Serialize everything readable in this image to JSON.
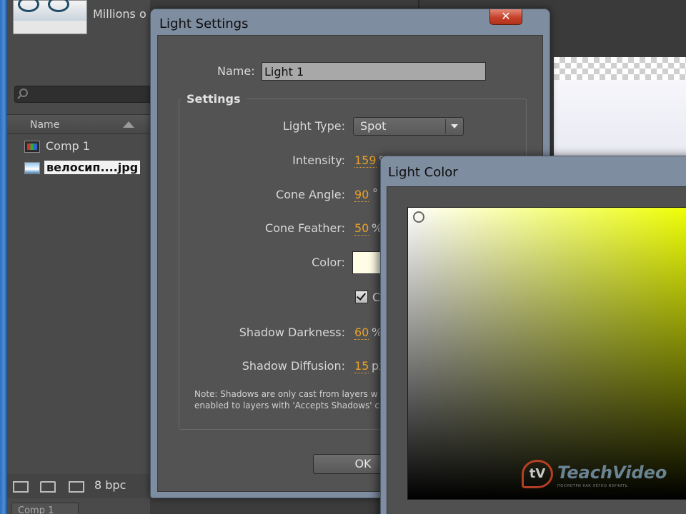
{
  "project_panel": {
    "thumb_info": "Millions o",
    "search_placeholder": "",
    "column_name": "Name",
    "items": [
      {
        "label": "Comp 1",
        "icon": "composition-icon",
        "selected": false
      },
      {
        "label": "велосип....jpg",
        "icon": "image-file-icon",
        "selected": true
      }
    ],
    "bpc": "8 bpc",
    "bottom_tab": "Comp 1"
  },
  "light_settings": {
    "title": "Light Settings",
    "close": "✕",
    "name_label": "Name:",
    "name_value": "Light 1",
    "group_title": "Settings",
    "light_type_label": "Light Type:",
    "light_type_value": "Spot",
    "intensity_label": "Intensity:",
    "intensity_value": "159",
    "intensity_unit": "%",
    "cone_angle_label": "Cone Angle:",
    "cone_angle_value": "90",
    "cone_angle_unit": "°",
    "cone_feather_label": "Cone Feather:",
    "cone_feather_value": "50",
    "cone_feather_unit": "%",
    "color_label": "Color:",
    "color_hex": "#fffde6",
    "casts_shadows_label": "Ca",
    "casts_shadows_checked": true,
    "shadow_darkness_label": "Shadow Darkness:",
    "shadow_darkness_value": "60",
    "shadow_darkness_unit": "%",
    "shadow_diffusion_label": "Shadow Diffusion:",
    "shadow_diffusion_value": "15",
    "shadow_diffusion_unit": "px",
    "note_line1": "Note: Shadows are only cast from layers w",
    "note_line2": "enabled to layers with 'Accepts Shadows' c",
    "ok_label": "OK"
  },
  "light_color": {
    "title": "Light Color",
    "hue_hex": "#eeff00"
  },
  "watermark": {
    "logo": "tV",
    "name": "TeachVideo",
    "tagline": "ПОСМОТРИ КАК ЛЕГКО ИЗУЧИТЬ"
  },
  "colors": {
    "accent_value": "#e8a12a",
    "dialog_frame": "#7f8da0",
    "close_red": "#c6412a"
  }
}
